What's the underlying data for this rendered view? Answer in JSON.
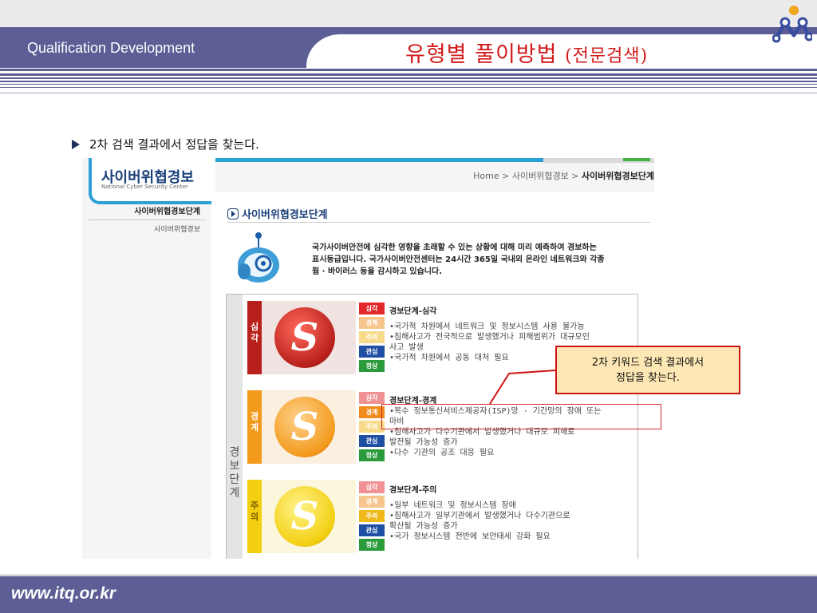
{
  "header": {
    "label": "Qualification Development",
    "title_main": "유형별 풀이방법",
    "title_sub": "(전문검색)"
  },
  "bullet": {
    "text": "2차 검색 결과에서 정답을 찾는다."
  },
  "screenshot": {
    "site_title": "사이버위협경보",
    "site_subtitle": "National Cyber Security Center",
    "breadcrumb": {
      "home": "Home",
      "sep1": ">",
      "item1": "사이버위협경보",
      "sep2": ">",
      "current": "사이버위협경보단계"
    },
    "nav": {
      "active": "사이버위협경보단계",
      "item": "사이버위협경보"
    },
    "section_title": "사이버위협경보단계",
    "intro_lines": [
      "국가사이버안전에 심각한 영향을 초래할 수 있는 상황에 대해 미리 예측하여 경보하는",
      "표시등급입니다. 국가사이버안전센터는 24시간 365일 국내외 온라인 네트워크와 각종",
      "웜 · 바이러스 등을 감시하고 있습니다."
    ],
    "levels_side_label": [
      "경",
      "보",
      "단",
      "계"
    ],
    "badge_labels": [
      "심각",
      "경계",
      "주의",
      "관심",
      "정상"
    ],
    "levels": [
      {
        "strip_label": [
          "심",
          "각"
        ],
        "symbol": "S",
        "title": "경보단계-심각",
        "lines": [
          "•국가적 차원에서 네트워크 및 정보시스템 사용 불가능",
          "•침해사고가 전국적으로 발생했거나 피해범위가 대규모인",
          " 사고 발생",
          "•국가적 차원에서 공동 대처 필요"
        ]
      },
      {
        "strip_label": [
          "경",
          "계"
        ],
        "symbol": "S",
        "title": "경보단계-경계",
        "lines": [
          "•복수 정보통신서비스제공자(ISP)망 · 기간망의 장애 또는",
          " 마비",
          "•침해사고가 다수기관에서 발생했거나 대규모 피해로",
          " 발전될 가능성 증가",
          "•다수 기관의 공조 대응 필요"
        ]
      },
      {
        "strip_label": [
          "주",
          "의"
        ],
        "symbol": "S",
        "title": "경보단계-주의",
        "lines": [
          "•일부 네트워크 및 정보시스템 장애",
          "•침해사고가 일부기관에서 발생했거나 다수기관으로",
          " 확산될 가능성 증가",
          "•국가 정보시스템 전반에 보안태세 강화 필요"
        ]
      }
    ]
  },
  "callout": {
    "line1": "2차 키워드 검색 결과에서",
    "line2": "정답을 찾는다."
  },
  "footer": {
    "url": "www.itq.or.kr"
  },
  "colors": {
    "brand": "#5c5e95",
    "title_red": "#d21a1a",
    "callout_bg": "#fde7b4",
    "callout_border": "#cf1414",
    "level_red": "#b8201c",
    "level_orange": "#f39a1d",
    "level_yellow": "#f3cf12",
    "badge_red": "#e2282b",
    "badge_orange": "#f08c1b",
    "badge_yellow": "#f0b91a",
    "badge_blue": "#1f4fa3",
    "badge_green": "#2a9a3a"
  }
}
